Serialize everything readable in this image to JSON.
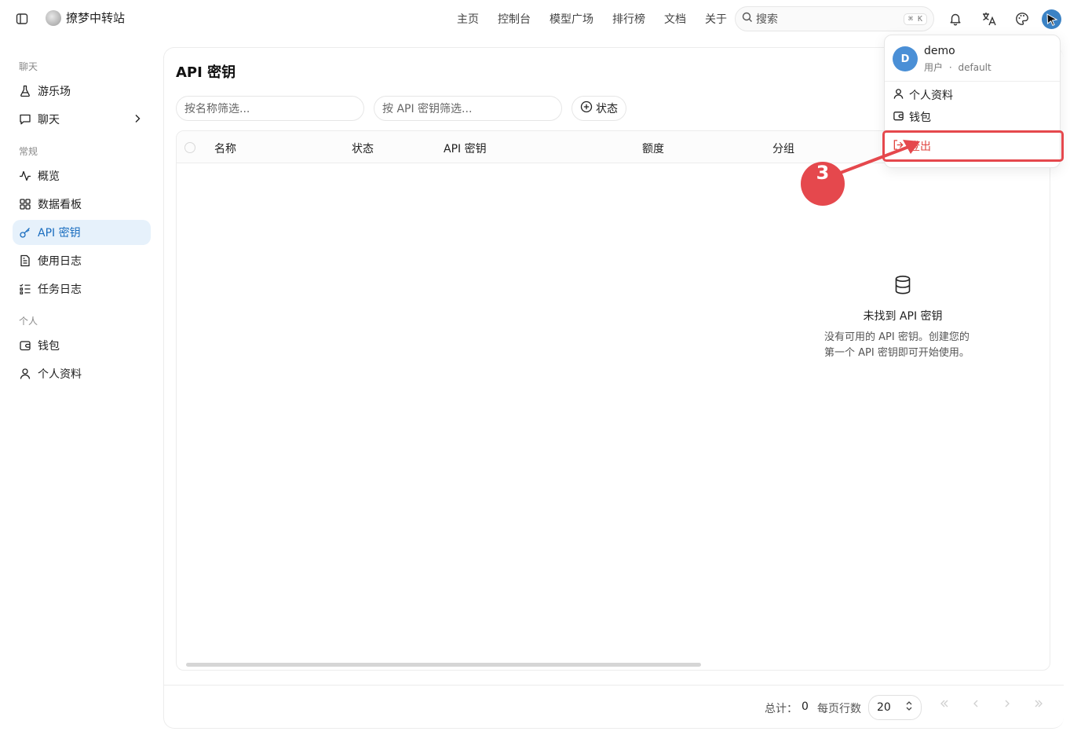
{
  "header": {
    "brand_name": "撩梦中转站",
    "nav": [
      "主页",
      "控制台",
      "模型广场",
      "排行榜",
      "文档",
      "关于"
    ],
    "search_placeholder": "搜索",
    "search_shortcut": "⌘ K"
  },
  "sidebar": {
    "groups": {
      "chat": "聊天",
      "general": "常规",
      "personal": "个人"
    },
    "items": [
      {
        "label": "游乐场",
        "icon": "flask-icon"
      },
      {
        "label": "聊天",
        "icon": "chat-icon"
      },
      {
        "label": "概览",
        "icon": "activity-icon"
      },
      {
        "label": "数据看板",
        "icon": "dashboard-icon"
      },
      {
        "label": "API 密钥",
        "icon": "key-icon"
      },
      {
        "label": "使用日志",
        "icon": "log-icon"
      },
      {
        "label": "任务日志",
        "icon": "task-list-icon"
      },
      {
        "label": "钱包",
        "icon": "wallet-icon"
      },
      {
        "label": "个人资料",
        "icon": "user-icon"
      }
    ]
  },
  "main": {
    "title": "API 密钥",
    "filter_name_placeholder": "按名称筛选...",
    "filter_key_placeholder": "按 API 密钥筛选...",
    "status_label": "状态",
    "columns": [
      "名称",
      "状态",
      "API 密钥",
      "额度",
      "分组"
    ],
    "empty_title": "未找到 API 密钥",
    "empty_desc_line1": "没有可用的 API 密钥。创建您的",
    "empty_desc_line2": "第一个 API 密钥即可开始使用。"
  },
  "footer": {
    "total_label": "总计：",
    "total_value": "0",
    "rows_per_page_label": "每页行数",
    "rows_per_page_value": "20"
  },
  "dropdown": {
    "avatar_letter": "D",
    "username": "demo",
    "role": "用户",
    "separator": "·",
    "group": "default",
    "profile_label": "个人资料",
    "wallet_label": "钱包",
    "logout_label": "登出"
  },
  "annotation": {
    "step_number": "3",
    "color": "#e5484d"
  }
}
